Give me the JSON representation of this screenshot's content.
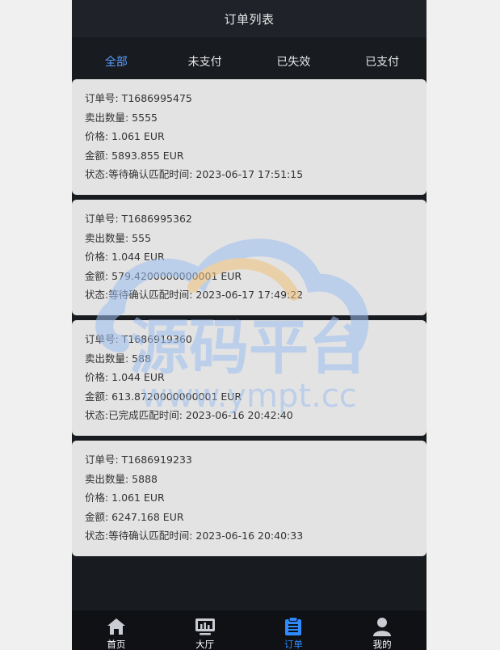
{
  "header": {
    "title": "订单列表"
  },
  "tabs": [
    {
      "label": "全部",
      "active": true
    },
    {
      "label": "未支付",
      "active": false
    },
    {
      "label": "已失效",
      "active": false
    },
    {
      "label": "已支付",
      "active": false
    }
  ],
  "orders": [
    {
      "order_no": "订单号: T1686995475",
      "quantity": "卖出数量: 5555",
      "price": "价格: 1.061 EUR",
      "amount": "金额: 5893.855 EUR",
      "status": "状态:等待确认匹配时间: 2023-06-17 17:51:15"
    },
    {
      "order_no": "订单号: T1686995362",
      "quantity": "卖出数量: 555",
      "price": "价格: 1.044 EUR",
      "amount": "金额: 579.4200000000001 EUR",
      "status": "状态:等待确认匹配时间: 2023-06-17 17:49:22"
    },
    {
      "order_no": "订单号: T1686919360",
      "quantity": "卖出数量: 588",
      "price": "价格: 1.044 EUR",
      "amount": "金额: 613.8720000000001 EUR",
      "status": "状态:已完成匹配时间: 2023-06-16 20:42:40"
    },
    {
      "order_no": "订单号: T1686919233",
      "quantity": "卖出数量: 5888",
      "price": "价格: 1.061 EUR",
      "amount": "金额: 6247.168 EUR",
      "status": "状态:等待确认匹配时间: 2023-06-16 20:40:33"
    }
  ],
  "watermark": {
    "text": "源码平台",
    "url": "www.ympt.cc"
  },
  "tabbar": [
    {
      "label": "首页",
      "icon": "home-icon",
      "active": false
    },
    {
      "label": "大厅",
      "icon": "chart-board-icon",
      "active": false
    },
    {
      "label": "订单",
      "icon": "order-list-icon",
      "active": true
    },
    {
      "label": "我的",
      "icon": "user-icon",
      "active": false
    }
  ],
  "colors": {
    "background": "#181b20",
    "card": "#e3e3e3",
    "active_tab": "#5aa0ff",
    "active_tabbar": "#2f8bff",
    "watermark_blue": "#9ebff0",
    "watermark_orange": "#f0c27a"
  }
}
